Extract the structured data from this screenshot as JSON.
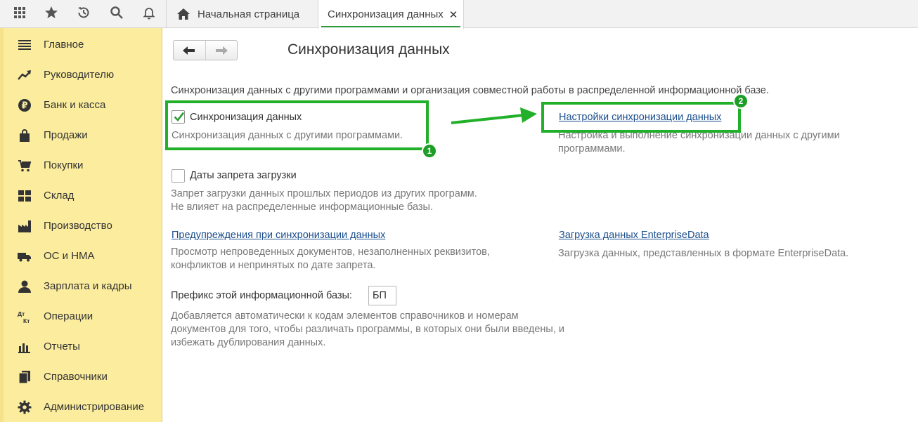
{
  "topbar": {
    "icons": [
      "apps-grid-icon",
      "star-icon",
      "history-icon",
      "search-icon",
      "bell-icon"
    ],
    "tabs": [
      {
        "label": "Начальная страница",
        "icon": "home-icon"
      },
      {
        "label": "Синхронизация данных",
        "close": "✕"
      }
    ]
  },
  "sidebar": {
    "items": [
      {
        "label": "Главное",
        "icon": "menu-lines-icon"
      },
      {
        "label": "Руководителю",
        "icon": "trend-icon"
      },
      {
        "label": "Банк и касса",
        "icon": "ruble-icon"
      },
      {
        "label": "Продажи",
        "icon": "shopping-bag-icon"
      },
      {
        "label": "Покупки",
        "icon": "cart-icon"
      },
      {
        "label": "Склад",
        "icon": "warehouse-icon"
      },
      {
        "label": "Производство",
        "icon": "factory-icon"
      },
      {
        "label": "ОС и НМА",
        "icon": "truck-icon"
      },
      {
        "label": "Зарплата и кадры",
        "icon": "person-icon"
      },
      {
        "label": "Операции",
        "icon": "dt-kt-icon"
      },
      {
        "label": "Отчеты",
        "icon": "bar-chart-icon"
      },
      {
        "label": "Справочники",
        "icon": "books-icon"
      },
      {
        "label": "Администрирование",
        "icon": "gear-icon"
      }
    ],
    "dt_kt": {
      "dt": "Дт",
      "kt": "Кт"
    }
  },
  "main": {
    "nav": {
      "back": "🡐",
      "forward": "🡒"
    },
    "title": "Синхронизация данных",
    "intro": "Синхронизация данных с другими программами и организация совместной работы в распределенной информационной базе.",
    "sync": {
      "checked": true,
      "label": "Синхронизация данных",
      "desc": "Синхронизация данных с другими программами."
    },
    "sync_settings": {
      "link": "Настройки синхронизации данных",
      "desc": "Настройка и выполнение синхронизации данных с другими программами."
    },
    "load_ban": {
      "checked": false,
      "label": "Даты запрета загрузки",
      "desc_line1": "Запрет загрузки данных прошлых периодов из других программ.",
      "desc_line2": "Не влияет на распределенные информационные базы."
    },
    "warnings": {
      "link": "Предупреждения при синхронизации данных",
      "desc": "Просмотр непроведенных документов, незаполненных реквизитов, конфликтов и непринятых по дате запрета."
    },
    "enterprise_data": {
      "link": "Загрузка данных EnterpriseData",
      "desc": "Загрузка данных, представленных в формате EnterpriseData."
    },
    "prefix": {
      "label": "Префикс этой информационной базы:",
      "value": "БП",
      "desc": "Добавляется автоматически к кодам элементов справочников и номерам документов для того, чтобы различать программы, в которых они были введены, и избежать дублирования данных."
    }
  },
  "annotations": {
    "badge1": "1",
    "badge2": "2",
    "color": "#22b02a"
  }
}
